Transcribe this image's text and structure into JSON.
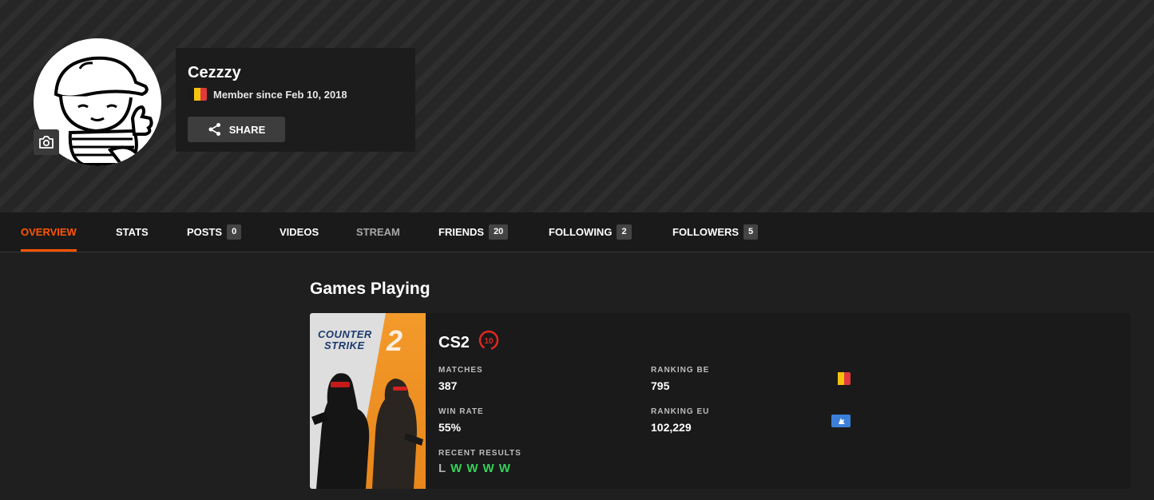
{
  "profile": {
    "username": "Cezzzy",
    "member_since": "Member since Feb 10, 2018",
    "country_flag_colors": [
      "#1a1a1a",
      "#f4c20d",
      "#e03a3e"
    ],
    "share_label": "SHARE"
  },
  "tabs": [
    {
      "label": "OVERVIEW",
      "count": null,
      "active": true
    },
    {
      "label": "STATS",
      "count": null
    },
    {
      "label": "POSTS",
      "count": "0"
    },
    {
      "label": "VIDEOS",
      "count": null
    },
    {
      "label": "STREAM",
      "count": null
    },
    {
      "label": "FRIENDS",
      "count": "20"
    },
    {
      "label": "FOLLOWING",
      "count": "2"
    },
    {
      "label": "FOLLOWERS",
      "count": "5"
    }
  ],
  "main": {
    "section_title": "Games Playing",
    "game": {
      "name": "CS2",
      "level": "10",
      "cover_title_line1": "COUNTER",
      "cover_title_line2": "STRIKE",
      "cover_number": "2",
      "matches_label": "MATCHES",
      "matches_value": "387",
      "win_rate_label": "WIN RATE",
      "win_rate_value": "55%",
      "ranking_country_label": "RANKING BE",
      "ranking_country_value": "795",
      "ranking_region_label": "RANKING EU",
      "ranking_region_value": "102,229",
      "recent_results_label": "RECENT RESULTS",
      "recent_results": [
        "L",
        "W",
        "W",
        "W",
        "W"
      ]
    }
  },
  "colors": {
    "accent": "#ff5500",
    "win": "#32d35a",
    "loss": "#b0b0b0",
    "level_badge": "#e0281f",
    "region_badge": "#3b7fd9"
  }
}
